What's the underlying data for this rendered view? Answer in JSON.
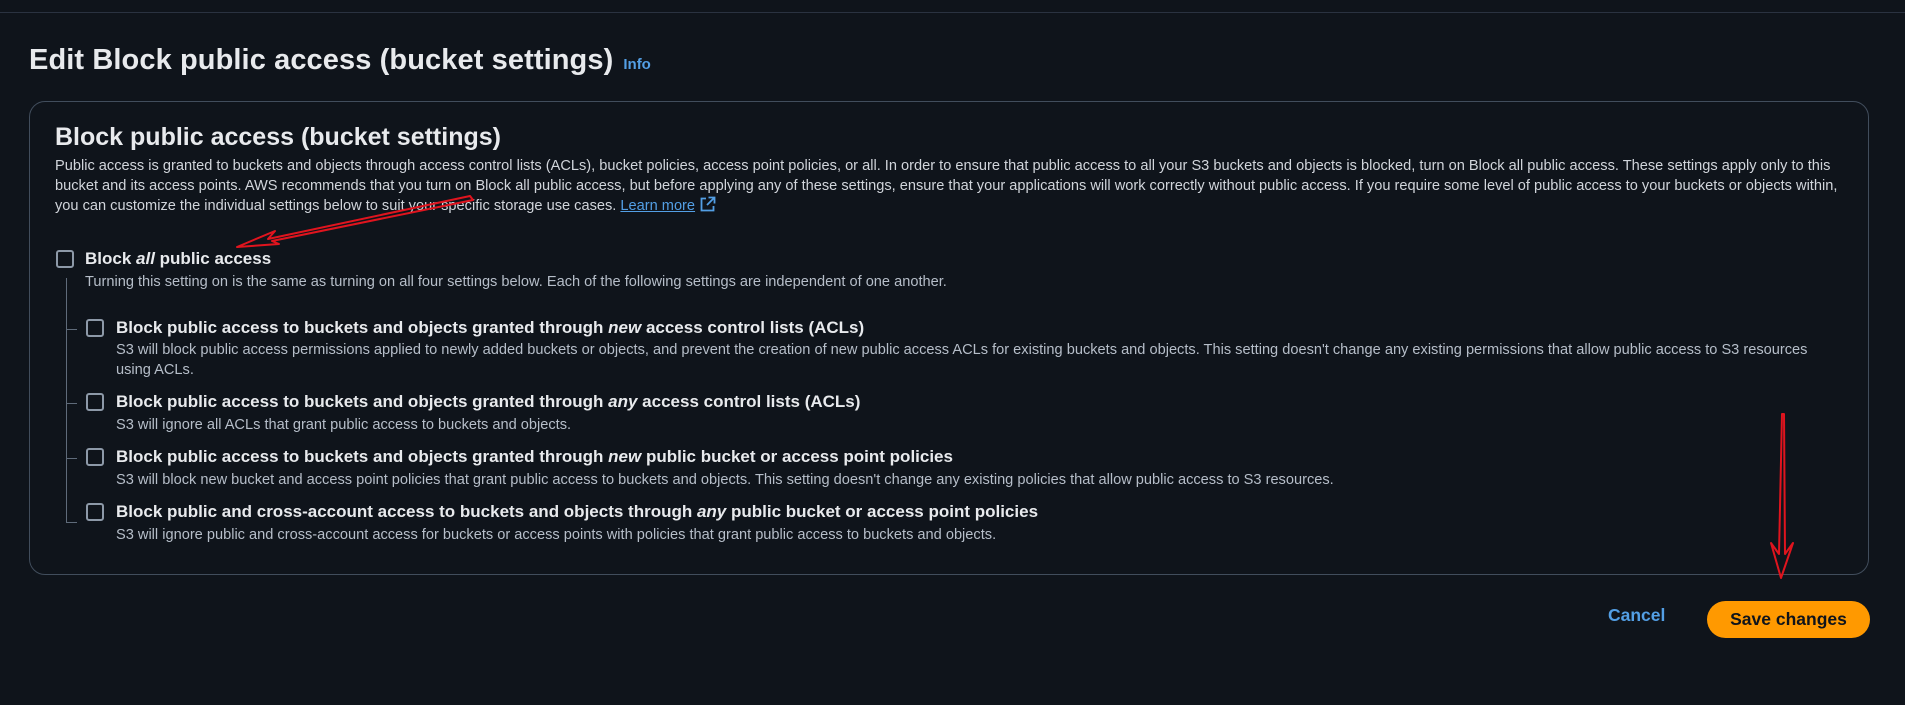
{
  "header": {
    "title": "Edit Block public access (bucket settings)",
    "info_label": "Info"
  },
  "section": {
    "title": "Block public access (bucket settings)",
    "description": "Public access is granted to buckets and objects through access control lists (ACLs), bucket policies, access point policies, or all. In order to ensure that public access to all your S3 buckets and objects is blocked, turn on Block all public access. These settings apply only to this bucket and its access points. AWS recommends that you turn on Block all public access, but before applying any of these settings, ensure that your applications will work correctly without public access. If you require some level of public access to your buckets or objects within, you can customize the individual settings below to suit your specific storage use cases.",
    "learn_more": "Learn more"
  },
  "block_all": {
    "label_pre": "Block ",
    "label_em": "all",
    "label_post": " public access",
    "description": "Turning this setting on is the same as turning on all four settings below. Each of the following settings are independent of one another.",
    "checked": false
  },
  "options": [
    {
      "label_pre": "Block public access to buckets and objects granted through ",
      "label_em": "new",
      "label_post": " access control lists (ACLs)",
      "description": "S3 will block public access permissions applied to newly added buckets or objects, and prevent the creation of new public access ACLs for existing buckets and objects. This setting doesn't change any existing permissions that allow public access to S3 resources using ACLs.",
      "checked": false
    },
    {
      "label_pre": "Block public access to buckets and objects granted through ",
      "label_em": "any",
      "label_post": " access control lists (ACLs)",
      "description": "S3 will ignore all ACLs that grant public access to buckets and objects.",
      "checked": false
    },
    {
      "label_pre": "Block public access to buckets and objects granted through ",
      "label_em": "new",
      "label_post": " public bucket or access point policies",
      "description": "S3 will block new bucket and access point policies that grant public access to buckets and objects. This setting doesn't change any existing policies that allow public access to S3 resources.",
      "checked": false
    },
    {
      "label_pre": "Block public and cross-account access to buckets and objects through ",
      "label_em": "any",
      "label_post": " public bucket or access point policies",
      "description": "S3 will ignore public and cross-account access for buckets or access points with policies that grant public access to buckets and objects.",
      "checked": false
    }
  ],
  "footer": {
    "cancel_label": "Cancel",
    "save_label": "Save changes"
  },
  "colors": {
    "background": "#0f141b",
    "link": "#539fe5",
    "primary_button": "#ff9900",
    "annotation_arrow": "#e0141e"
  }
}
